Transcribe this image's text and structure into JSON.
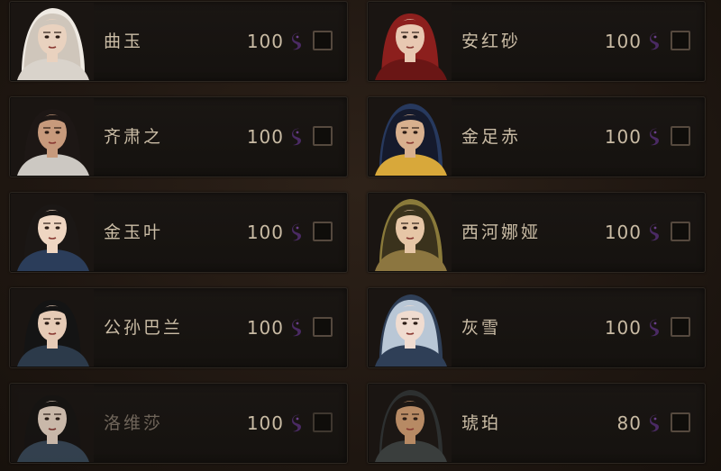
{
  "accent_colors": {
    "text": "#cbbda6",
    "text_dim": "#6f655a",
    "card_bg": "#1a1613",
    "checkbox_border": "#55493e",
    "cost_icon": "#4a2a63"
  },
  "cost_icon_name": "tadpole-coin-icon",
  "characters": [
    {
      "name": "曲玉",
      "cost": "100",
      "selected": false,
      "disabled": false,
      "hair": "#cfc6bb",
      "hood": "#efeae3",
      "skin": "#e9d2bf",
      "garment": "#d9d3cb"
    },
    {
      "name": "安红砂",
      "cost": "100",
      "selected": false,
      "disabled": false,
      "hair": "#8c1f1d",
      "hood": "",
      "skin": "#e8c8b2",
      "garment": "#6a1615"
    },
    {
      "name": "齐肃之",
      "cost": "100",
      "selected": false,
      "disabled": false,
      "hair": "#1d1715",
      "hood": "",
      "skin": "#c79a7c",
      "garment": "#ccc8c2"
    },
    {
      "name": "金足赤",
      "cost": "100",
      "selected": false,
      "disabled": false,
      "hair": "#151a2c",
      "hood": "#27395e",
      "skin": "#d8b08e",
      "garment": "#d8a83a"
    },
    {
      "name": "金玉叶",
      "cost": "100",
      "selected": false,
      "disabled": false,
      "hair": "#1b1715",
      "hood": "",
      "skin": "#efd6c2",
      "garment": "#2b3d5a"
    },
    {
      "name": "西河娜娅",
      "cost": "100",
      "selected": false,
      "disabled": false,
      "hair": "#3a321c",
      "hood": "#8a7a3a",
      "skin": "#e6c6a6",
      "garment": "#8c7640"
    },
    {
      "name": "公孙巴兰",
      "cost": "100",
      "selected": false,
      "disabled": false,
      "hair": "#141414",
      "hood": "",
      "skin": "#e6cbb6",
      "garment": "#2c3a4a"
    },
    {
      "name": "灰雪",
      "cost": "100",
      "selected": false,
      "disabled": false,
      "hair": "#b9c7d6",
      "hood": "#2f3f57",
      "skin": "#f0dcd0",
      "garment": "#2f3f57"
    },
    {
      "name": "洛维莎",
      "cost": "100",
      "selected": false,
      "disabled": true,
      "hair": "#161413",
      "hood": "",
      "skin": "#f0dccb",
      "garment": "#3a4b5c"
    },
    {
      "name": "琥珀",
      "cost": "80",
      "selected": false,
      "disabled": false,
      "hair": "#1c1714",
      "hood": "#2d3030",
      "skin": "#b78a64",
      "garment": "#3a3e3d"
    }
  ]
}
